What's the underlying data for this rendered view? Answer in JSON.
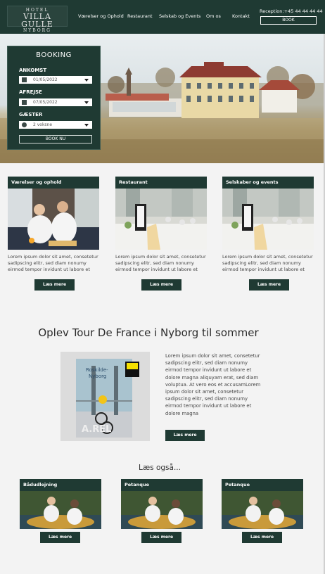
{
  "header": {
    "logo_top": "HOTEL",
    "logo_main": "VILLA GULLE",
    "logo_bottom": "NYBORG",
    "nav": [
      "Værelser og Ophold",
      "Restaurant",
      "Selskab og Events",
      "Om os",
      "Kontakt"
    ],
    "reception": "Reception:+45 44 44 44 44",
    "book_label": "BOOK"
  },
  "booking": {
    "title": "BOOKING",
    "arrival_label": "ANKOMST",
    "arrival_value": "01/05/2022",
    "departure_label": "AFREJSE",
    "departure_value": "07/05/2022",
    "guests_label": "GÆSTER",
    "guests_value": "2 voksne",
    "submit_label": "BOOK NU"
  },
  "cards": [
    {
      "title": "Værelser og ophold",
      "text": "Lorem ipsum dolor sit amet, consetetur sadipscing elitr, sed diam nonumy eirmod tempor invidunt ut labore et",
      "button": "Læs mere"
    },
    {
      "title": "Restaurant",
      "text": "Lorem ipsum dolor sit amet, consetetur sadipscing elitr, sed diam nonumy eirmod tempor invidunt ut labore et",
      "button": "Læs mere"
    },
    {
      "title": "Selskaber og events",
      "text": "Lorem ipsum dolor sit amet, consetetur sadipscing elitr, sed diam nonumy eirmod tempor invidunt ut labore et",
      "button": "Læs mere"
    }
  ],
  "tour": {
    "title": "Oplev Tour De France i Nyborg til sommer",
    "poster_line1": "Roskilde-",
    "poster_line2": "Nyborg",
    "poster_bottom": "A.REL",
    "text": "Lorem ipsum dolor sit amet, consetetur sadipscing elitr, sed diam nonumy eirmod tempor invidunt ut labore et dolore magna aliquyam erat, sed diam voluptua. At vero eos et accusamLorem ipsum dolor sit amet, consetetur sadipscing elitr, sed diam nonumy eirmod tempor invidunt ut labore et dolore magna",
    "button": "Læs mere"
  },
  "read_also": {
    "title": "Læs også...",
    "items": [
      {
        "title": "Bådudlejning",
        "button": "Læs mere"
      },
      {
        "title": "Petanque",
        "button": "Læs mere"
      },
      {
        "title": "Petanque",
        "button": "Læs mere"
      }
    ]
  },
  "colors": {
    "primary": "#1f3a33",
    "background": "#f3f3f3"
  }
}
